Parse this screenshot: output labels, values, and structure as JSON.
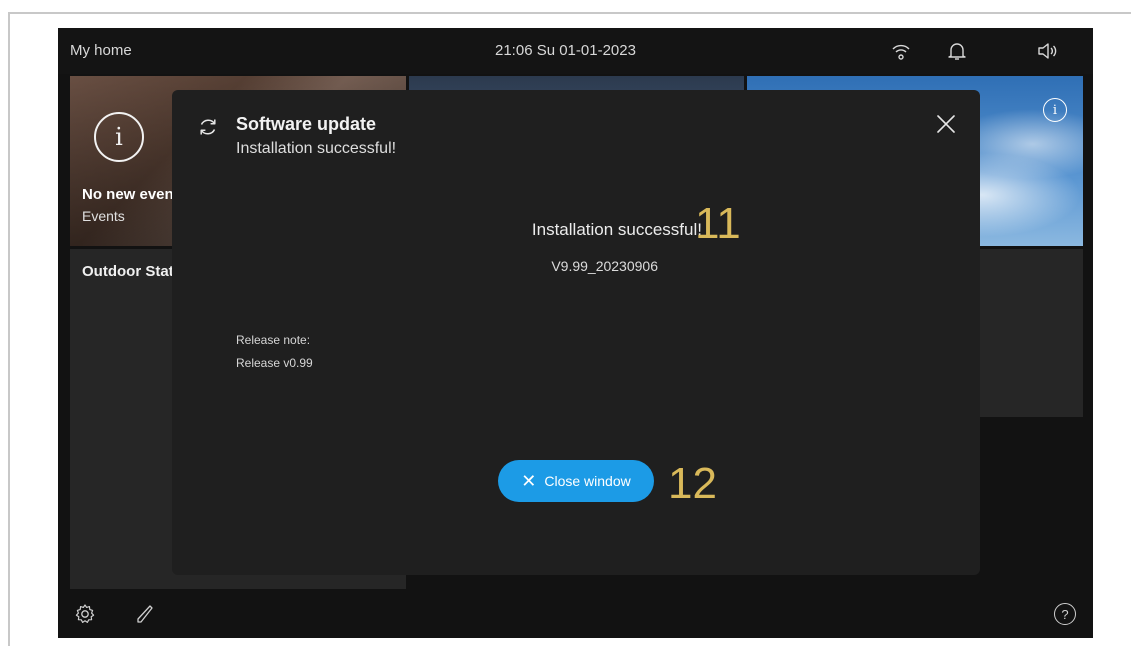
{
  "status_bar": {
    "title": "My home",
    "datetime": "21:06  Su 01-01-2023",
    "icons": [
      "wifi-icon",
      "bell-icon",
      "speaker-icon"
    ]
  },
  "tiles": {
    "events": {
      "icon": "info-icon",
      "title": "No new events",
      "subtitle": "Events"
    },
    "outdoor": {
      "label": "Outdoor Station"
    },
    "sky": {
      "icon": "info-icon"
    }
  },
  "dialog": {
    "icon": "sync-icon",
    "title": "Software update",
    "subtitle": "Installation successful!",
    "message": "Installation successful!",
    "version": "V9.99_20230906",
    "release_note_label": "Release note:",
    "release_note_text": "Release v0.99",
    "close_icon": "close-icon",
    "button_label": "Close window"
  },
  "callouts": {
    "first": "11",
    "second": "12"
  },
  "bottom_bar": {
    "icons": [
      "settings-icon",
      "edit-icon",
      "help-icon"
    ],
    "help_glyph": "?"
  },
  "colors": {
    "accent": "#1c9be6",
    "callout": "#d9b95a",
    "background": "#121212",
    "dialog": "#1f1f1f"
  }
}
